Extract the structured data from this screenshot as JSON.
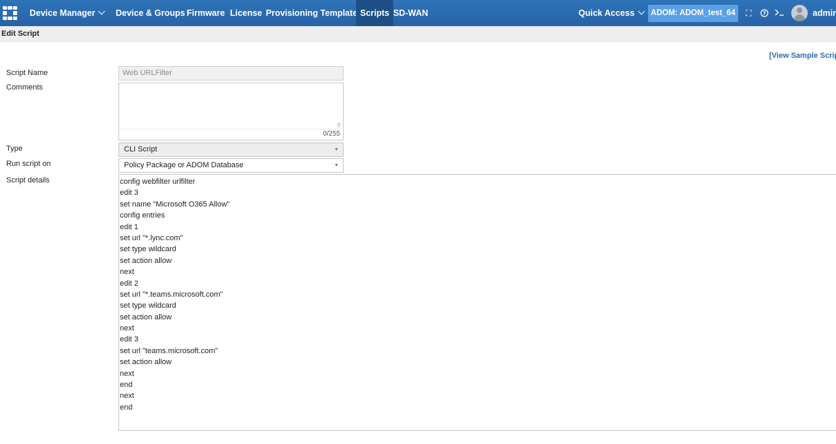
{
  "nav": {
    "device_manager": "Device Manager",
    "items": [
      "Device & Groups",
      "Firmware",
      "License",
      "Provisioning Templates",
      "Scripts",
      "SD-WAN"
    ],
    "quick_access": "Quick Access",
    "adom": "ADOM: ADOM_test_64",
    "user": "admin"
  },
  "page": {
    "title": "Edit Script",
    "sample_link": "[View Sample Scrip"
  },
  "form": {
    "script_name_label": "Script Name",
    "script_name_value": "Web URLFilter",
    "comments_label": "Comments",
    "comments_value": "",
    "comments_counter": "0/255",
    "type_label": "Type",
    "type_value": "CLI Script",
    "run_on_label": "Run script on",
    "run_on_value": "Policy Package or ADOM Database",
    "details_label": "Script details"
  },
  "script_lines": [
    "config webfilter urlfilter",
    "edit 3",
    "set name \"Microsoft O365 Allow\"",
    "config entries",
    "edit 1",
    "set url \"*.lync.com\"",
    "set type wildcard",
    "set action allow",
    "next",
    "edit 2",
    "set url \"*.teams.microsoft.com\"",
    "set type wildcard",
    "set action allow",
    "next",
    "edit 3",
    "set url \"teams.microsoft.com\"",
    "set action allow",
    "next",
    "end",
    "next",
    "end"
  ],
  "colors": {
    "topbar": "#2763a5",
    "active_tab": "#1e4f86",
    "adom_badge": "#5aa0e6",
    "link": "#2a6db0"
  },
  "icons": [
    "fortinet-logo-icon",
    "chevron-down-icon",
    "fullscreen-icon",
    "help-icon",
    "cli-console-icon",
    "user-avatar-icon",
    "dropdown-arrow-icon"
  ]
}
